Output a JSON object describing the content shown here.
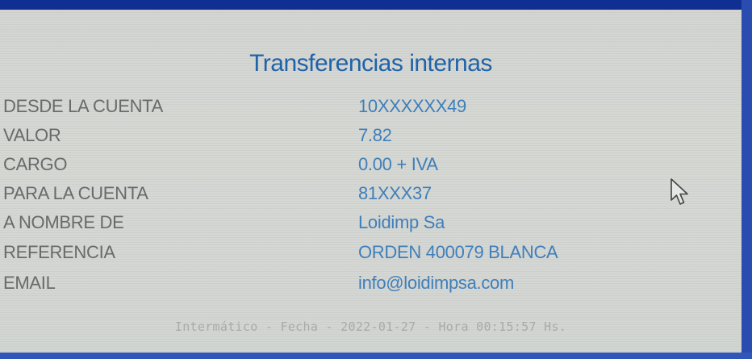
{
  "title": "Transferencias internas",
  "rows": [
    {
      "label": "DESDE LA CUENTA",
      "value": "10XXXXXX49"
    },
    {
      "label": "VALOR",
      "value": "7.82"
    },
    {
      "label": "CARGO",
      "value": "0.00 + IVA"
    },
    {
      "label": "PARA LA CUENTA",
      "value": "81XXX37"
    },
    {
      "label": "A NOMBRE DE",
      "value": "Loidimp Sa"
    },
    {
      "label": "REFERENCIA",
      "value": "ORDEN 400079 BLANCA"
    },
    {
      "label": "EMAIL",
      "value": "info@loidimpsa.com"
    }
  ],
  "footer": "Intermático - Fecha - 2022-01-27 - Hora 00:15:57 Hs.",
  "icons": {
    "cursor": "mouse-pointer-icon"
  },
  "colors": {
    "title": "#1f63a8",
    "label": "#6a6a6a",
    "value": "#3f7fba",
    "frame": "#0f2f93"
  }
}
